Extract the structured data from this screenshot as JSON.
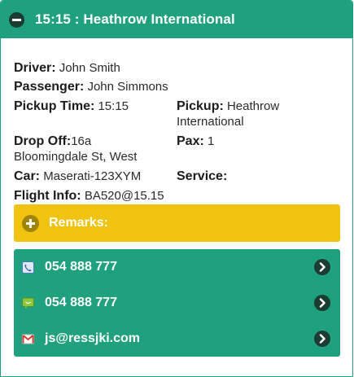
{
  "header": {
    "title": "15:15 : Heathrow International"
  },
  "details": {
    "driver_label": "Driver:",
    "driver_value": "John Smith",
    "passenger_label": "Passenger:",
    "passenger_value": "John Simmons",
    "pickup_time_label": "Pickup Time:",
    "pickup_time_value": "15:15",
    "pickup_label": "Pickup:",
    "pickup_value_line1": "Heathrow",
    "pickup_value_line2": "International",
    "dropoff_label": "Drop Off:",
    "dropoff_value_line1": "16a",
    "dropoff_value_line2": "Bloomingdale St, West",
    "pax_label": "Pax:",
    "pax_value": "1",
    "car_label": "Car:",
    "car_value": "Maserati-123XYM",
    "service_label": "Service:",
    "flight_label": "Flight Info:",
    "flight_value": "BA520@15.15"
  },
  "remarks": {
    "label": "Remarks:"
  },
  "contacts": [
    {
      "icon": "phone-icon",
      "text": "054 888 777"
    },
    {
      "icon": "sms-icon",
      "text": "054 888 777"
    },
    {
      "icon": "email-icon",
      "text": "js@ressjki.com"
    }
  ],
  "colors": {
    "primary": "#1fa07f",
    "remarks": "#f0c30f",
    "dark": "#1b3b33"
  }
}
